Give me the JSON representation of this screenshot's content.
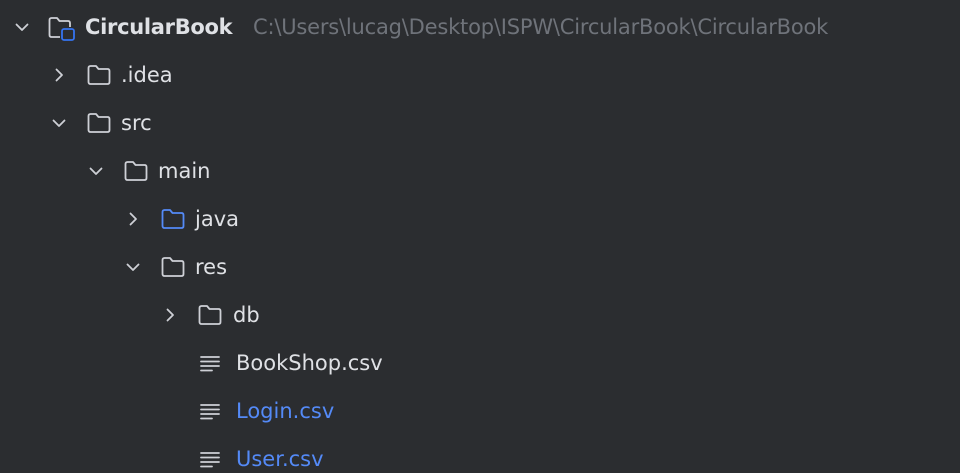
{
  "colors": {
    "background": "#2b2d30",
    "text": "#dfe1e5",
    "path_text": "#6f737a",
    "icon_gray": "#ced0d6",
    "accent_blue": "#548af7",
    "module_badge": "#3574f0"
  },
  "tree": {
    "root": {
      "label": "CircularBook",
      "path": "C:\\Users\\lucag\\Desktop\\ISPW\\CircularBook\\CircularBook",
      "icon": "module-folder-icon",
      "expanded": true
    },
    "items": [
      {
        "label": ".idea",
        "icon": "folder-icon",
        "expanded": false
      },
      {
        "label": "src",
        "icon": "folder-icon",
        "expanded": true
      },
      {
        "label": "main",
        "icon": "folder-icon",
        "expanded": true
      },
      {
        "label": "java",
        "icon": "source-folder-icon",
        "expanded": false
      },
      {
        "label": "res",
        "icon": "folder-icon",
        "expanded": true
      },
      {
        "label": "db",
        "icon": "folder-icon",
        "expanded": false
      },
      {
        "label": "BookShop.csv",
        "icon": "text-file-icon"
      },
      {
        "label": "Login.csv",
        "icon": "text-file-icon",
        "modified": true
      },
      {
        "label": "User.csv",
        "icon": "text-file-icon",
        "modified": true
      }
    ]
  }
}
